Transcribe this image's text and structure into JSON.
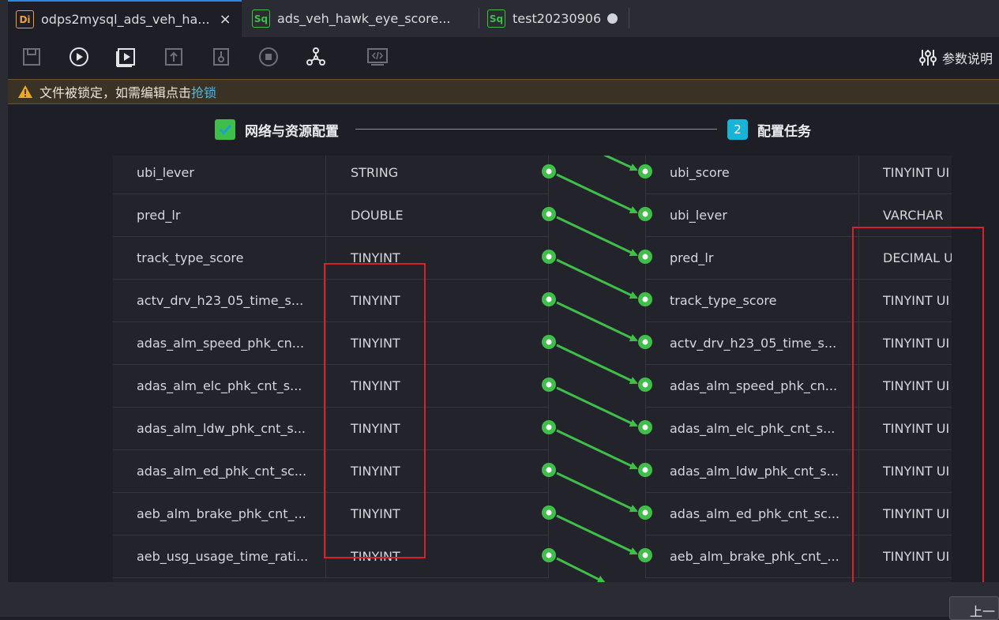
{
  "tabs": [
    {
      "badge": "Di",
      "title": "odps2mysql_ads_veh_ha...",
      "close": "×"
    },
    {
      "badge": "Sq",
      "title": "ads_veh_hawk_eye_score..."
    },
    {
      "badge": "Sq",
      "title": "test20230906"
    }
  ],
  "toolbar": {
    "params_label": "参数说明"
  },
  "lock_bar": {
    "message": "文件被锁定，如需编辑点击",
    "action": "抢锁"
  },
  "steps": [
    {
      "label": "网络与资源配置",
      "state": "done"
    },
    {
      "number": "2",
      "label": "配置任务",
      "state": "current"
    }
  ],
  "source_fields": [
    {
      "name": "ubi_lever",
      "type": "STRING"
    },
    {
      "name": "pred_lr",
      "type": "DOUBLE"
    },
    {
      "name": "track_type_score",
      "type": "TINYINT"
    },
    {
      "name": "actv_drv_h23_05_time_s...",
      "type": "TINYINT"
    },
    {
      "name": "adas_alm_speed_phk_cn...",
      "type": "TINYINT"
    },
    {
      "name": "adas_alm_elc_phk_cnt_s...",
      "type": "TINYINT"
    },
    {
      "name": "adas_alm_ldw_phk_cnt_s...",
      "type": "TINYINT"
    },
    {
      "name": "adas_alm_ed_phk_cnt_sc...",
      "type": "TINYINT"
    },
    {
      "name": "aeb_alm_brake_phk_cnt_...",
      "type": "TINYINT"
    },
    {
      "name": "aeb_usg_usage_time_rati...",
      "type": "TINYINT"
    }
  ],
  "target_fields": [
    {
      "name": "ubi_score",
      "type": "TINYINT UI"
    },
    {
      "name": "ubi_lever",
      "type": "VARCHAR"
    },
    {
      "name": "pred_lr",
      "type": "DECIMAL U"
    },
    {
      "name": "track_type_score",
      "type": "TINYINT UI"
    },
    {
      "name": "actv_drv_h23_05_time_s...",
      "type": "TINYINT UI"
    },
    {
      "name": "adas_alm_speed_phk_cn...",
      "type": "TINYINT UI"
    },
    {
      "name": "adas_alm_elc_phk_cnt_s...",
      "type": "TINYINT UI"
    },
    {
      "name": "adas_alm_ldw_phk_cnt_s...",
      "type": "TINYINT UI"
    },
    {
      "name": "adas_alm_ed_phk_cnt_sc...",
      "type": "TINYINT UI"
    },
    {
      "name": "aeb_alm_brake_phk_cnt_...",
      "type": "TINYINT UI"
    }
  ],
  "bottom": {
    "prev_label": "上一"
  },
  "colors": {
    "link": "#3fbf4a",
    "highlight": "#d8212a",
    "accent": "#17b3d8"
  }
}
